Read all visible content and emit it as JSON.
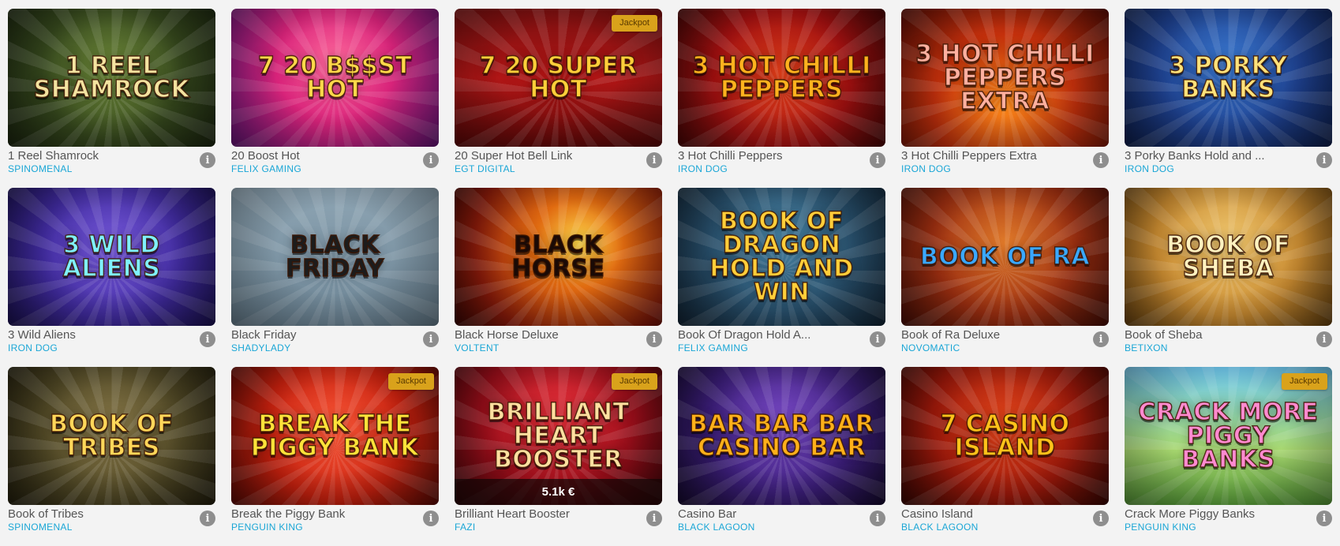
{
  "games": [
    {
      "name": "1 Reel Shamrock",
      "provider": "SPINOMENAL",
      "thumb": {
        "title": "1 Reel Shamrock",
        "bg": "radial-gradient(circle at 50% 45%, #6f8a3a 0%, #34461c 55%, #1c2710 100%)",
        "color": "#f3e3a0"
      }
    },
    {
      "name": "20 Boost Hot",
      "provider": "FELIX GAMING",
      "thumb": {
        "title": "7 20 B$$ST HOT",
        "bg": "radial-gradient(circle at 50% 40%, #ff6a9c 0%, #d8237a 45%, #6a1680 100%)",
        "color": "#ffd84a"
      }
    },
    {
      "name": "20 Super Hot Bell Link",
      "provider": "EGT DIGITAL",
      "badge": "Jackpot",
      "thumb": {
        "title": "7 20 Super Hot",
        "bg": "linear-gradient(180deg, #7a0f0f 0%, #b21616 50%, #5e0808 100%)",
        "color": "#ffcf3a"
      }
    },
    {
      "name": "3 Hot Chilli Peppers",
      "provider": "IRON DOG",
      "thumb": {
        "title": "3 Hot Chilli Peppers",
        "bg": "radial-gradient(circle at 50% 50%, #e0401a 0%, #a01010 55%, #4a0606 100%)",
        "color": "#ffb21e"
      }
    },
    {
      "name": "3 Hot Chilli Peppers Extra",
      "provider": "IRON DOG",
      "thumb": {
        "title": "3 Hot Chilli Peppers Extra",
        "bg": "radial-gradient(circle at 50% 70%, #ff8a1a 0%, #c4300c 50%, #5a0c04 100%)",
        "color": "#ffb0a0"
      }
    },
    {
      "name": "3 Porky Banks Hold and ...",
      "provider": "IRON DOG",
      "thumb": {
        "title": "3 Porky Banks",
        "bg": "radial-gradient(circle at 50% 40%, #3a78d0 0%, #1d3f8c 55%, #0e1f4e 100%)",
        "color": "#ffe27a"
      }
    },
    {
      "name": "3 Wild Aliens",
      "provider": "IRON DOG",
      "thumb": {
        "title": "3 Wild Aliens",
        "bg": "radial-gradient(circle at 50% 45%, #7a5ce0 0%, #3f2a9c 55%, #1b1154 100%)",
        "color": "#7ff0ff"
      }
    },
    {
      "name": "Black Friday",
      "provider": "SHADYLADY",
      "thumb": {
        "title": "Black Friday",
        "bg": "linear-gradient(180deg, #8ea5b4 0%, #6c8494 100%)",
        "color": "#1c1c1c"
      }
    },
    {
      "name": "Black Horse Deluxe",
      "provider": "VOLTENT",
      "thumb": {
        "title": "Black Horse",
        "bg": "radial-gradient(circle at 60% 40%, #ffd84a 0%, #e06a10 30%, #8a1a0a 70%, #3a0604 100%)",
        "color": "#1a0a06"
      }
    },
    {
      "name": "Book Of Dragon Hold A...",
      "provider": "FELIX GAMING",
      "thumb": {
        "title": "Book of Dragon Hold and Win",
        "bg": "radial-gradient(circle at 50% 40%, #4a86a8 0%, #274e6a 55%, #122536 100%)",
        "color": "#ffce3a"
      }
    },
    {
      "name": "Book of Ra Deluxe",
      "provider": "NOVOMATIC",
      "thumb": {
        "title": "Book of Ra",
        "bg": "radial-gradient(circle at 50% 40%, #e07a2a 0%, #9c2e10 55%, #4a0e06 100%)",
        "color": "#3aa8ff"
      }
    },
    {
      "name": "Book of Sheba",
      "provider": "BETIXON",
      "thumb": {
        "title": "Book of Sheba",
        "bg": "radial-gradient(circle at 50% 40%, #f0c870 0%, #c88a30 55%, #6a4410 100%)",
        "color": "#fff2c0"
      }
    },
    {
      "name": "Book of Tribes",
      "provider": "SPINOMENAL",
      "thumb": {
        "title": "Book of Tribes",
        "bg": "radial-gradient(circle at 50% 45%, #8a7a4a 0%, #4e4624 55%, #24200e 100%)",
        "color": "#ffd75a"
      }
    },
    {
      "name": "Break the Piggy Bank",
      "provider": "PENGUIN KING",
      "badge": "Jackpot",
      "thumb": {
        "title": "Break the Piggy Bank",
        "bg": "radial-gradient(circle at 50% 45%, #ff5a3a 0%, #c4200e 55%, #5e0a04 100%)",
        "color": "#ffe23a"
      }
    },
    {
      "name": "Brilliant Heart Booster",
      "provider": "FAZI",
      "badge": "Jackpot",
      "jackpot_amount": "5.1k €",
      "thumb": {
        "title": "Brilliant Heart Booster",
        "bg": "radial-gradient(circle at 50% 35%, #e8303a 0%, #9c0e1a 55%, #3e0408 100%)",
        "color": "#ffe0a0"
      }
    },
    {
      "name": "Casino Bar",
      "provider": "BLACK LAGOON",
      "thumb": {
        "title": "Bar Bar Bar Casino Bar",
        "bg": "radial-gradient(circle at 50% 40%, #7a4ac8 0%, #3c1e7a 55%, #160a30 100%)",
        "color": "#ffb01a"
      }
    },
    {
      "name": "Casino Island",
      "provider": "BLACK LAGOON",
      "thumb": {
        "title": "7 Casino Island",
        "bg": "radial-gradient(circle at 50% 40%, #e0441a 0%, #9c180a 55%, #3a0602 100%)",
        "color": "#ffc21a"
      }
    },
    {
      "name": "Crack More Piggy Banks",
      "provider": "PENGUIN KING",
      "badge": "Jackpot",
      "thumb": {
        "title": "Crack More Piggy Banks",
        "bg": "linear-gradient(180deg, #6ec8f0 0%, #a8d870 60%, #5aa03a 100%)",
        "color": "#ff8ad0"
      }
    }
  ]
}
